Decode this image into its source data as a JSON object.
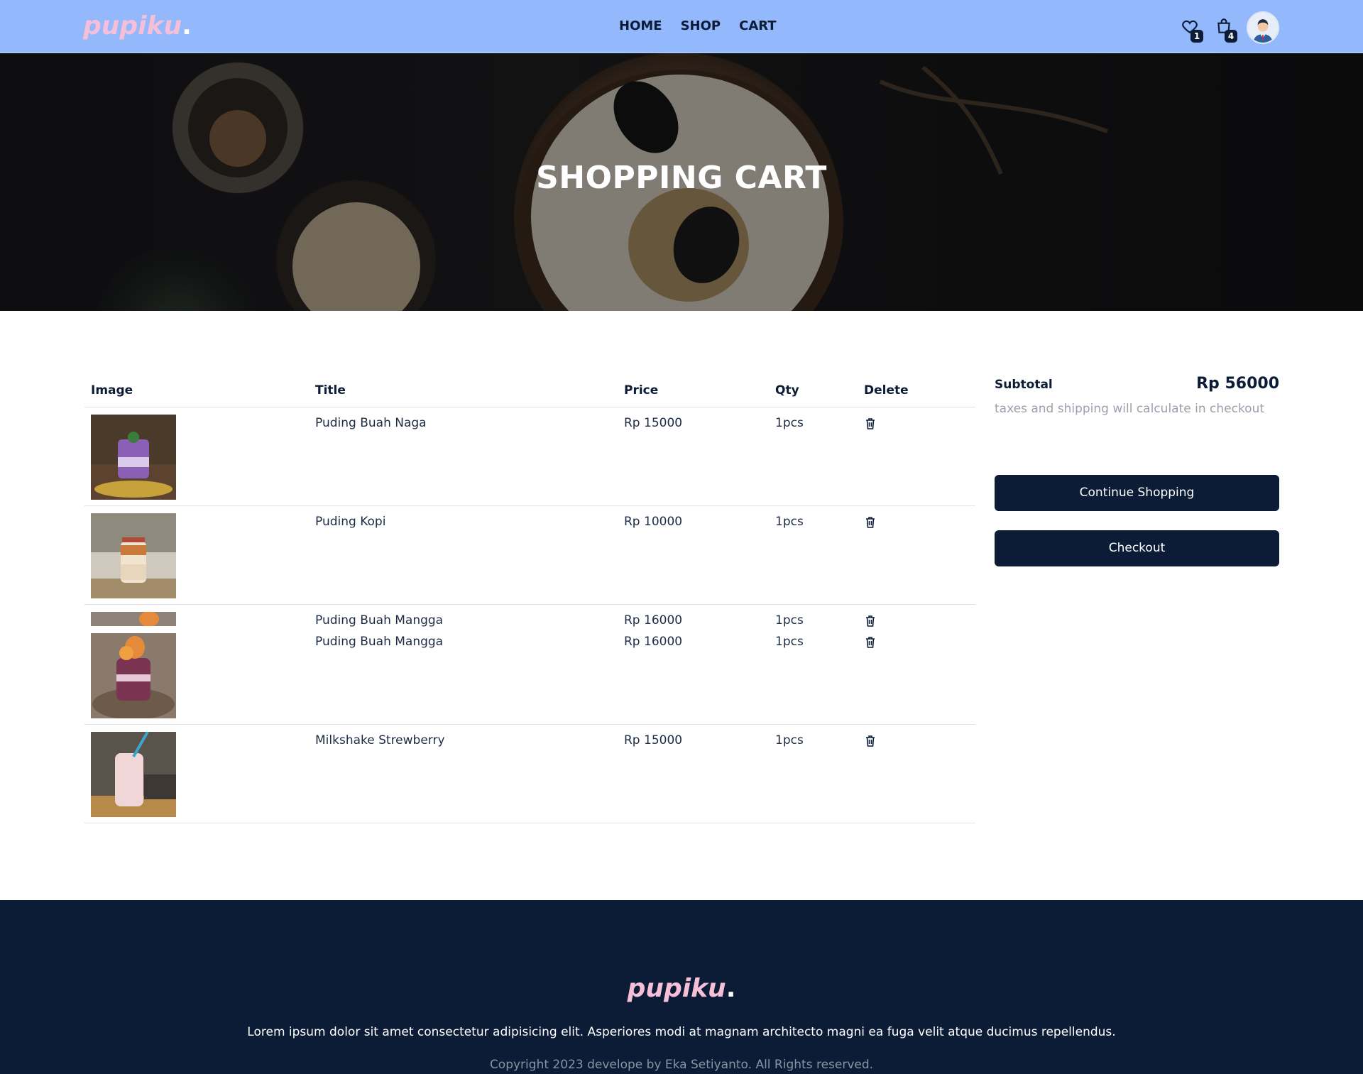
{
  "brand": {
    "name": "pupiku",
    "dot": "."
  },
  "nav": {
    "links": [
      {
        "label": "HOME"
      },
      {
        "label": "SHOP"
      },
      {
        "label": "CART"
      }
    ],
    "wishlist_count": "1",
    "bag_count": "4"
  },
  "hero": {
    "title": "SHOPPING CART"
  },
  "cart": {
    "headers": {
      "image": "Image",
      "title": "Title",
      "price": "Price",
      "qty": "Qty",
      "delete": "Delete"
    },
    "items": [
      {
        "title": "Puding Buah Naga",
        "price": "Rp 15000",
        "qty": "1pcs"
      },
      {
        "title": "Puding Kopi",
        "price": "Rp 10000",
        "qty": "1pcs"
      },
      {
        "title": "Puding Buah Mangga",
        "price": "Rp 16000",
        "qty": "1pcs"
      },
      {
        "title": "Puding Buah Mangga",
        "price": "Rp 16000",
        "qty": "1pcs"
      },
      {
        "title": "Milkshake Strewberry",
        "price": "Rp 15000",
        "qty": "1pcs"
      }
    ]
  },
  "summary": {
    "subtotal_label": "Subtotal",
    "subtotal_value": "Rp 56000",
    "note": "taxes and shipping will calculate in checkout",
    "continue_label": "Continue Shopping",
    "checkout_label": "Checkout"
  },
  "footer": {
    "description": "Lorem ipsum dolor sit amet consectetur adipisicing elit. Asperiores modi at magnam architecto magni ea fuga velit atque ducimus repellendus.",
    "copyright": "Copyright 2023 develope by Eka Setiyanto. All Rights reserved."
  },
  "colors": {
    "navbar": "#93b8fb",
    "navy": "#0c1c36",
    "brand_pink": "#f6bfd8"
  },
  "icons": [
    "heart-icon",
    "shopping-bag-icon",
    "avatar",
    "trash-icon"
  ]
}
